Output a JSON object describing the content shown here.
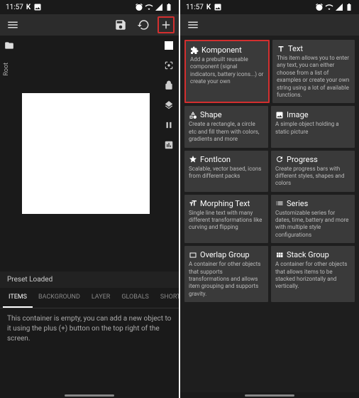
{
  "status": {
    "time": "11:57"
  },
  "left": {
    "root_label": "Root",
    "preset_loaded": "Preset Loaded",
    "tabs": [
      "ITEMS",
      "BACKGROUND",
      "LAYER",
      "GLOBALS",
      "SHORTCU"
    ],
    "empty_msg": "This container is empty, you can add a new object to it using the plus (+) button on the top right of the screen."
  },
  "cards": [
    {
      "title": "Komponent",
      "desc": "Add a prebuilt reusable component (signal indicators, battery icons...) or create your own"
    },
    {
      "title": "Text",
      "desc": "This item allows you to enter any text, you can either choose from a list of examples or create your own string using a lot of available functions."
    },
    {
      "title": "Shape",
      "desc": "Create a rectangle, a circle etc and fill them with colors, gradients and more"
    },
    {
      "title": "Image",
      "desc": "A simple object holding a static picture"
    },
    {
      "title": "FontIcon",
      "desc": "Scalable, vector based, icons from different packs"
    },
    {
      "title": "Progress",
      "desc": "Create progress bars with different styles, shapes and colors"
    },
    {
      "title": "Morphing Text",
      "desc": "Single line text with many different transformations like curving and flipping"
    },
    {
      "title": "Series",
      "desc": "Customizable series for dates, time, battery and more with multiple style configurations"
    },
    {
      "title": "Overlap Group",
      "desc": "A container for other objects that supports transformations and allows item grouping and supports gravity."
    },
    {
      "title": "Stack Group",
      "desc": "A container for other objects that allows items to be stacked horizontally and vertically."
    }
  ]
}
